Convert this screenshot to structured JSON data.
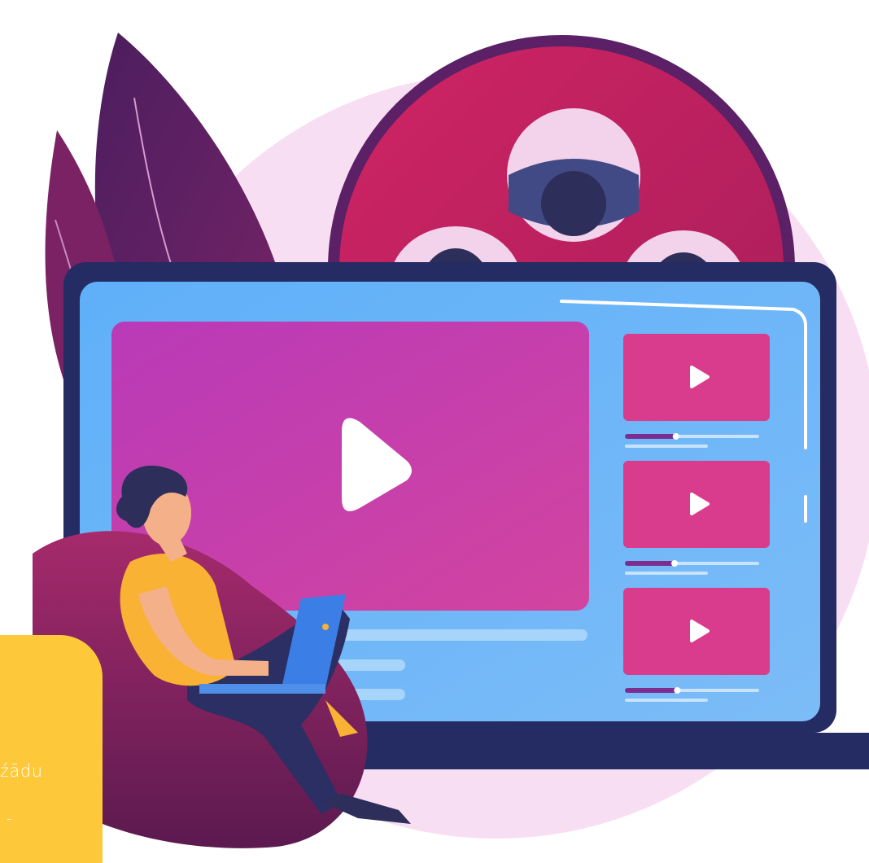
{
  "caption": {
    "line1": "źādu",
    "line2": "-"
  },
  "colors": {
    "background_circle": "#f7dcf2",
    "leaf_dark": "#5a2066",
    "leaf_magenta": "#8b2470",
    "reel": "#c92467",
    "reel_hole": "#2d2e59",
    "monitor_frame": "#252b63",
    "screen": "#6fb7f9",
    "video_player": "#c440b5",
    "thumbnail": "#d93c8d",
    "progress_fill": "#7d2d8f",
    "caption_card": "#fdc83a",
    "shirt": "#f9b233",
    "beanbag": "#9a2770"
  },
  "icons": [
    "play-icon",
    "film-reel-icon",
    "leaf-icon",
    "laptop-icon"
  ],
  "thumbnail_progress": [
    0.38,
    0.37,
    0.39
  ]
}
